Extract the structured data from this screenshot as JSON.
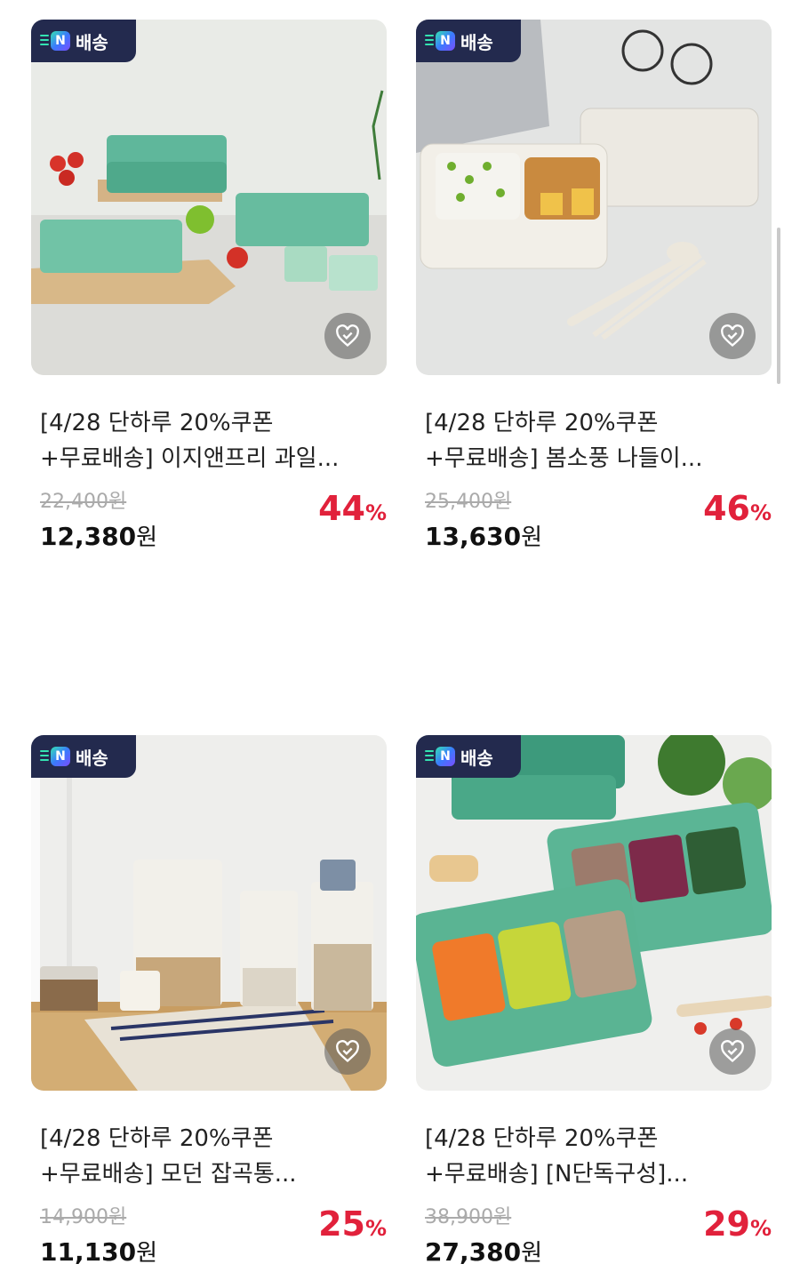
{
  "badge_label": "배송",
  "badge_logo": "N",
  "colors": {
    "discount": "#e1213b",
    "badge_bg": "#232a4e",
    "price": "#111111",
    "original_price": "#aaaaaa"
  },
  "products": [
    {
      "title_line1": "[4/28 단하루 20%쿠폰",
      "title_line2": "+무료배송] 이지앤프리 과일...",
      "original_price": "22,400원",
      "sale_price": "12,380",
      "sale_unit": "원",
      "discount": "44",
      "discount_unit": "%",
      "image": "green-divided-food-containers",
      "heart_icon": "heart-check-icon"
    },
    {
      "title_line1": "[4/28 단하루 20%쿠폰",
      "title_line2": "+무료배송] 봄소풍 나들이...",
      "original_price": "25,400원",
      "sale_price": "13,630",
      "sale_unit": "원",
      "discount": "46",
      "discount_unit": "%",
      "image": "lunch-box-with-spoon-chopsticks",
      "heart_icon": "heart-check-icon"
    },
    {
      "title_line1": "[4/28 단하루 20%쿠폰",
      "title_line2": "+무료배송] 모던 잡곡통...",
      "original_price": "14,900원",
      "sale_price": "11,130",
      "sale_unit": "원",
      "discount": "25",
      "discount_unit": "%",
      "image": "grain-storage-containers",
      "heart_icon": "heart-check-icon"
    },
    {
      "title_line1": "[4/28 단하루 20%쿠폰",
      "title_line2": "+무료배송] [N단독구성]...",
      "original_price": "38,900원",
      "sale_price": "27,380",
      "sale_unit": "원",
      "discount": "29",
      "discount_unit": "%",
      "image": "baby-food-containers",
      "heart_icon": "heart-check-icon"
    }
  ]
}
